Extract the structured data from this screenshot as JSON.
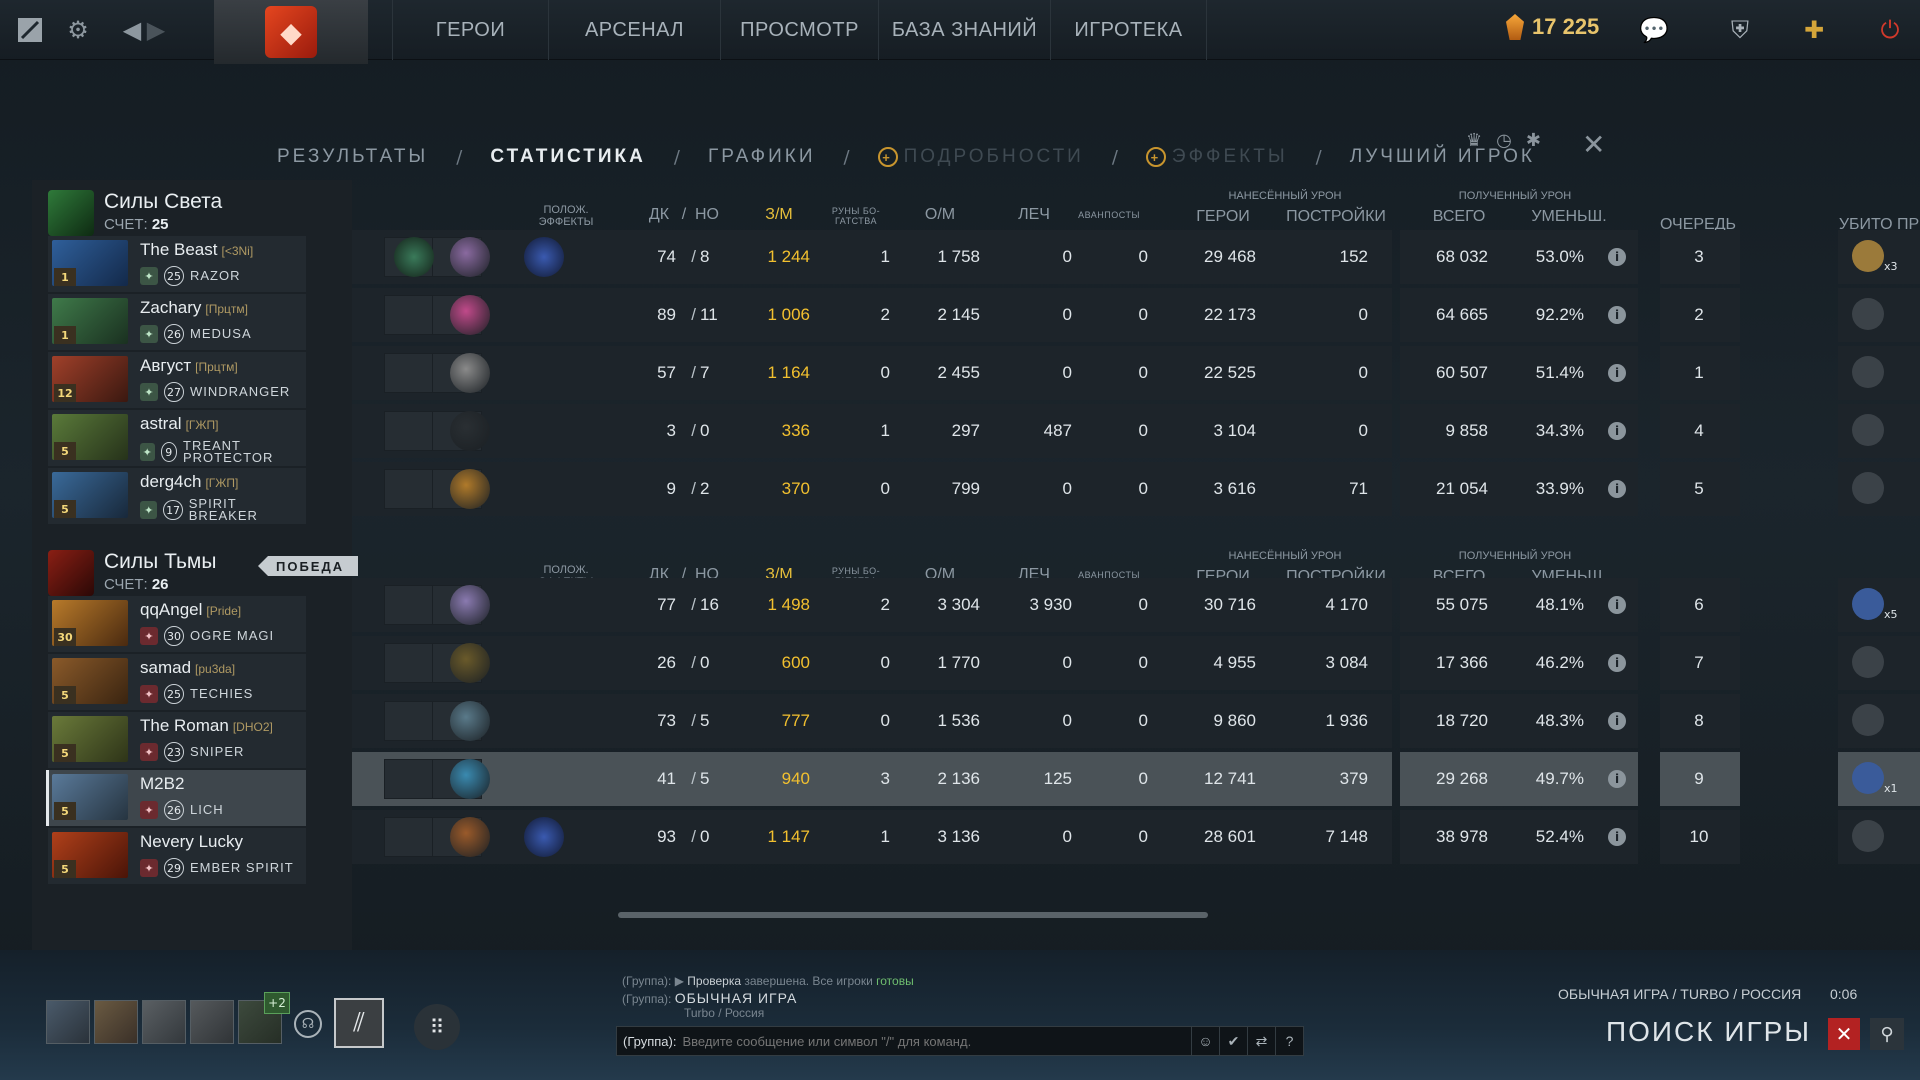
{
  "topnav": {
    "items": [
      "ГЕРОИ",
      "АРСЕНАЛ",
      "ПРОСМОТР",
      "БАЗА ЗНАНИЙ",
      "ИГРОТЕКА"
    ],
    "shards": "17 225"
  },
  "subtabs": {
    "items": [
      {
        "label": "РЕЗУЛЬТАТЫ",
        "state": "normal"
      },
      {
        "label": "СТАТИСТИКА",
        "state": "active"
      },
      {
        "label": "ГРАФИКИ",
        "state": "normal"
      },
      {
        "label": "ПОДРОБНОСТИ",
        "state": "locked"
      },
      {
        "label": "ЭФФЕКТЫ",
        "state": "locked"
      },
      {
        "label": "ЛУЧШИЙ ИГРОК",
        "state": "normal"
      }
    ],
    "separator": "/"
  },
  "headers": {
    "effects": "ПОЛОЖ. ЭФФЕКТЫ",
    "kd_k": "ДК",
    "kd_sep": "/",
    "kd_d": "НО",
    "gpm": "З/М",
    "runes": "РУНЫ БО-ГАТСТВА",
    "xpm": "О/М",
    "heal": "ЛЕЧ",
    "aghs": "АВАНПОСТЫ",
    "dealt_group": "НАНЕСЁННЫЙ УРОН",
    "dealt_heroes": "ГЕРОИ",
    "dealt_buildings": "ПОСТРОЙКИ",
    "taken_group": "ПОЛУЧЕННЫЙ УРОН",
    "taken_total": "ВСЕГО",
    "taken_reduced": "УМЕНЬШ.",
    "order": "ОЧЕРЕДЬ",
    "killed_by": "УБИТО ПР"
  },
  "radiant": {
    "name": "Силы Света",
    "score_label": "СЧЕТ:",
    "score": "25",
    "players": [
      {
        "name": "The Beast",
        "tag": "[<3Ni]",
        "level": "1",
        "hero_level": "25",
        "hero": "RAZOR",
        "k": "74",
        "d": "8",
        "gpm": "1 244",
        "runes": "1",
        "xpm": "1 758",
        "heal": "0",
        "outposts": "0",
        "dmg_heroes": "29 468",
        "dmg_buildings": "152",
        "taken_total": "68 032",
        "taken_reduced": "53.0%",
        "order": "3",
        "kill_count": "x3"
      },
      {
        "name": "Zachary",
        "tag": "[Прцтм]",
        "level": "1",
        "hero_level": "26",
        "hero": "MEDUSA",
        "k": "89",
        "d": "11",
        "gpm": "1 006",
        "runes": "2",
        "xpm": "2 145",
        "heal": "0",
        "outposts": "0",
        "dmg_heroes": "22 173",
        "dmg_buildings": "0",
        "taken_total": "64 665",
        "taken_reduced": "92.2%",
        "order": "2",
        "kill_count": ""
      },
      {
        "name": "Август",
        "tag": "[Прцтм]",
        "level": "12",
        "hero_level": "27",
        "hero": "WINDRANGER",
        "k": "57",
        "d": "7",
        "gpm": "1 164",
        "runes": "0",
        "xpm": "2 455",
        "heal": "0",
        "outposts": "0",
        "dmg_heroes": "22 525",
        "dmg_buildings": "0",
        "taken_total": "60 507",
        "taken_reduced": "51.4%",
        "order": "1",
        "kill_count": ""
      },
      {
        "name": "astral",
        "tag": "[ГЖП]",
        "level": "5",
        "hero_level": "9",
        "hero": "TREANT PROTECTOR",
        "k": "3",
        "d": "0",
        "gpm": "336",
        "runes": "1",
        "xpm": "297",
        "heal": "487",
        "outposts": "0",
        "dmg_heroes": "3 104",
        "dmg_buildings": "0",
        "taken_total": "9 858",
        "taken_reduced": "34.3%",
        "order": "4",
        "kill_count": ""
      },
      {
        "name": "derg4ch",
        "tag": "[ГЖП]",
        "level": "5",
        "hero_level": "17",
        "hero": "SPIRIT BREAKER",
        "k": "9",
        "d": "2",
        "gpm": "370",
        "runes": "0",
        "xpm": "799",
        "heal": "0",
        "outposts": "0",
        "dmg_heroes": "3 616",
        "dmg_buildings": "71",
        "taken_total": "21 054",
        "taken_reduced": "33.9%",
        "order": "5",
        "kill_count": ""
      }
    ]
  },
  "dire": {
    "name": "Силы Тьмы",
    "score_label": "СЧЕТ:",
    "score": "26",
    "win_badge": "ПОБЕДА",
    "players": [
      {
        "name": "qqAngel",
        "tag": "[Pride]",
        "level": "30",
        "hero_level": "30",
        "hero": "OGRE MAGI",
        "k": "77",
        "d": "16",
        "gpm": "1 498",
        "runes": "2",
        "xpm": "3 304",
        "heal": "3 930",
        "outposts": "0",
        "dmg_heroes": "30 716",
        "dmg_buildings": "4 170",
        "taken_total": "55 075",
        "taken_reduced": "48.1%",
        "order": "6",
        "kill_count": "x5"
      },
      {
        "name": "samad",
        "tag": "[pu3da]",
        "level": "5",
        "hero_level": "25",
        "hero": "TECHIES",
        "k": "26",
        "d": "0",
        "gpm": "600",
        "runes": "0",
        "xpm": "1 770",
        "heal": "0",
        "outposts": "0",
        "dmg_heroes": "4 955",
        "dmg_buildings": "3 084",
        "taken_total": "17 366",
        "taken_reduced": "46.2%",
        "order": "7",
        "kill_count": ""
      },
      {
        "name": "The Roman",
        "tag": "[DHO2]",
        "level": "5",
        "hero_level": "23",
        "hero": "SNIPER",
        "k": "73",
        "d": "5",
        "gpm": "777",
        "runes": "0",
        "xpm": "1 536",
        "heal": "0",
        "outposts": "0",
        "dmg_heroes": "9 860",
        "dmg_buildings": "1 936",
        "taken_total": "18 720",
        "taken_reduced": "48.3%",
        "order": "8",
        "kill_count": ""
      },
      {
        "name": "M2B2",
        "tag": "",
        "level": "5",
        "hero_level": "26",
        "hero": "LICH",
        "k": "41",
        "d": "5",
        "gpm": "940",
        "runes": "3",
        "xpm": "2 136",
        "heal": "125",
        "outposts": "0",
        "dmg_heroes": "12 741",
        "dmg_buildings": "379",
        "taken_total": "29 268",
        "taken_reduced": "49.7%",
        "order": "9",
        "kill_count": "x1"
      },
      {
        "name": "Nevery Lucky",
        "tag": "",
        "level": "5",
        "hero_level": "29",
        "hero": "EMBER SPIRIT",
        "k": "93",
        "d": "0",
        "gpm": "1 147",
        "runes": "1",
        "xpm": "3 136",
        "heal": "0",
        "outposts": "0",
        "dmg_heroes": "28 601",
        "dmg_buildings": "7 148",
        "taken_total": "38 978",
        "taken_reduced": "52.4%",
        "order": "10",
        "kill_count": ""
      }
    ]
  },
  "party": {
    "plus": "+2"
  },
  "chat": {
    "line1_prefix": "(Группа):",
    "line1_a": "Проверка",
    "line1_b": "завершена. Все игроки",
    "line1_c": "готовы",
    "line2_prefix": "(Группа):",
    "line2_text": "ОБЫЧНАЯ ИГРА",
    "line3_text": "Turbo / Россия",
    "input_label": "(Группа):",
    "input_placeholder": "Введите сообщение или символ \"/\" для команд."
  },
  "matchmaking": {
    "mode": "ОБЫЧНАЯ ИГРА / TURBO / РОССИЯ",
    "timer": "0:06",
    "title": "ПОИСК ИГРЫ"
  },
  "colors": {
    "gold": "#f2c02f",
    "accent_red": "#b32222",
    "win_badge": "#c6ccd0"
  }
}
